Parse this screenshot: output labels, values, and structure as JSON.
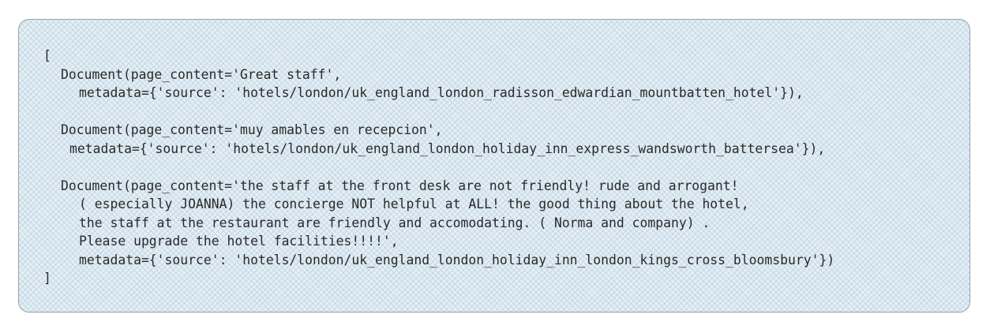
{
  "code": {
    "open_bracket": "[",
    "doc1_line1": "Document(page_content='Great staff',",
    "doc1_line2": "metadata={'source': 'hotels/london/uk_england_london_radisson_edwardian_mountbatten_hotel'}),",
    "doc2_line1": "Document(page_content='muy amables en recepcion',",
    "doc2_line2": "metadata={'source': 'hotels/london/uk_england_london_holiday_inn_express_wandsworth_battersea'}),",
    "doc3_line1": "Document(page_content='the staff at the front desk are not friendly! rude and arrogant!",
    "doc3_line2": "( especially JOANNA) the concierge NOT helpful at ALL! the good thing about the hotel,",
    "doc3_line3": "the staff at the restaurant are friendly and accomodating. ( Norma and company) .",
    "doc3_line4": "Please upgrade the hotel facilities!!!!',",
    "doc3_line5": "metadata={'source': 'hotels/london/uk_england_london_holiday_inn_london_kings_cross_bloomsbury'})",
    "close_bracket": "]"
  }
}
